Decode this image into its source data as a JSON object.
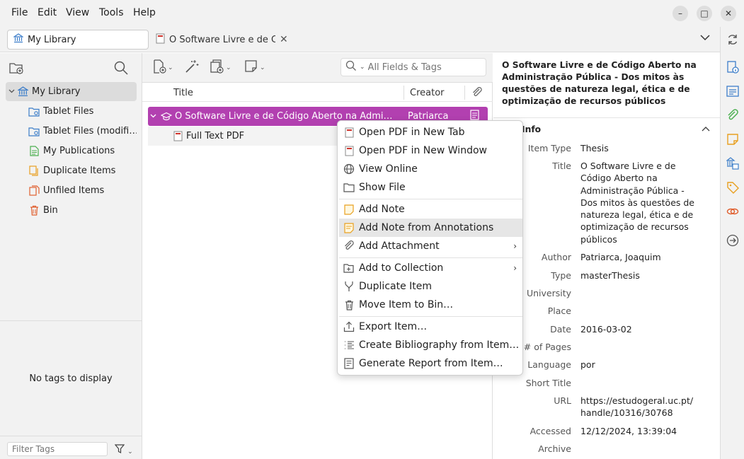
{
  "menubar": {
    "items": [
      "File",
      "Edit",
      "View",
      "Tools",
      "Help"
    ],
    "window_controls": {
      "minimize": "–",
      "maximize": "□",
      "close": "✕"
    }
  },
  "tabs": {
    "library_tab": "My Library",
    "item_tab": "O Software Livre e de Código",
    "close_glyph": "✕"
  },
  "left": {
    "collections": [
      {
        "label": "My Library",
        "icon": "library-icon"
      },
      {
        "label": "Tablet Files",
        "icon": "folder-tablet-icon"
      },
      {
        "label": "Tablet Files (modifi…",
        "icon": "folder-tablet-icon"
      },
      {
        "label": "My Publications",
        "icon": "publications-icon"
      },
      {
        "label": "Duplicate Items",
        "icon": "duplicate-icon"
      },
      {
        "label": "Unfiled Items",
        "icon": "unfiled-icon"
      },
      {
        "label": "Bin",
        "icon": "trash-icon"
      }
    ],
    "no_tags": "No tags to display",
    "filter_placeholder": "Filter Tags"
  },
  "middle": {
    "search_placeholder": "All Fields & Tags",
    "columns": {
      "title": "Title",
      "creator": "Creator"
    },
    "rows": [
      {
        "title": "O Software Livre e de Código Aberto na Administração Pública - Dos mitos às questões de natureza legal, ética e de optimização de recursos públicos",
        "creator": "Patriarca"
      },
      {
        "title": "Full Text PDF",
        "creator": ""
      }
    ]
  },
  "context_menu": {
    "items": [
      {
        "label": "Open PDF in New Tab",
        "icon": "pdf-icon"
      },
      {
        "label": "Open PDF in New Window",
        "icon": "pdf-icon"
      },
      {
        "label": "View Online",
        "icon": "globe-icon"
      },
      {
        "label": "Show File",
        "icon": "folder-icon"
      },
      {
        "label": "Add Note",
        "icon": "note-icon"
      },
      {
        "label": "Add Note from Annotations",
        "icon": "note-annotations-icon"
      },
      {
        "label": "Add Attachment",
        "icon": "paperclip-icon",
        "submenu": true
      },
      {
        "label": "Add to Collection",
        "icon": "add-collection-icon",
        "submenu": true
      },
      {
        "label": "Duplicate Item",
        "icon": "duplicate-item-icon"
      },
      {
        "label": "Move Item to Bin…",
        "icon": "trash-icon"
      },
      {
        "label": "Export Item…",
        "icon": "export-icon"
      },
      {
        "label": "Create Bibliography from Item…",
        "icon": "bibliography-icon"
      },
      {
        "label": "Generate Report from Item…",
        "icon": "report-icon"
      }
    ],
    "highlighted": "Add Note from Annotations"
  },
  "item_pane": {
    "heading": "O Software Livre e de Código Aberto na Administração Pública - Dos mitos às questões de natureza legal, ética e de optimização de recursos públicos",
    "section_label": "Info",
    "fields": {
      "item_type": {
        "label": "Item Type",
        "value": "Thesis"
      },
      "title": {
        "label": "Title",
        "value": "O Software Livre e de Código Aberto na Administração Pública - Dos mitos às questões de natureza legal, ética e de optimização de recursos públicos"
      },
      "author": {
        "label": "Author",
        "value": "Patriarca, Joaquim"
      },
      "type": {
        "label": "Type",
        "value": "masterThesis"
      },
      "university": {
        "label": "University",
        "value": ""
      },
      "place": {
        "label": "Place",
        "value": ""
      },
      "date": {
        "label": "Date",
        "value": "2016-03-02"
      },
      "pages": {
        "label": "# of Pages",
        "value": ""
      },
      "language": {
        "label": "Language",
        "value": "por"
      },
      "short_title": {
        "label": "Short Title",
        "value": ""
      },
      "url": {
        "label": "URL",
        "value": "https://estudogeral.uc.pt/handle/10316/30768"
      },
      "accessed": {
        "label": "Accessed",
        "value": "12/12/2024, 13:39:04"
      },
      "archive": {
        "label": "Archive",
        "value": ""
      }
    }
  },
  "colors": {
    "selection": "#b240b0",
    "chrome": "#f2f2f2",
    "accent_blue": "#3d7ec9",
    "accent_green": "#4caf50",
    "accent_orange": "#e8a020",
    "pdf_red": "#d0342c"
  }
}
